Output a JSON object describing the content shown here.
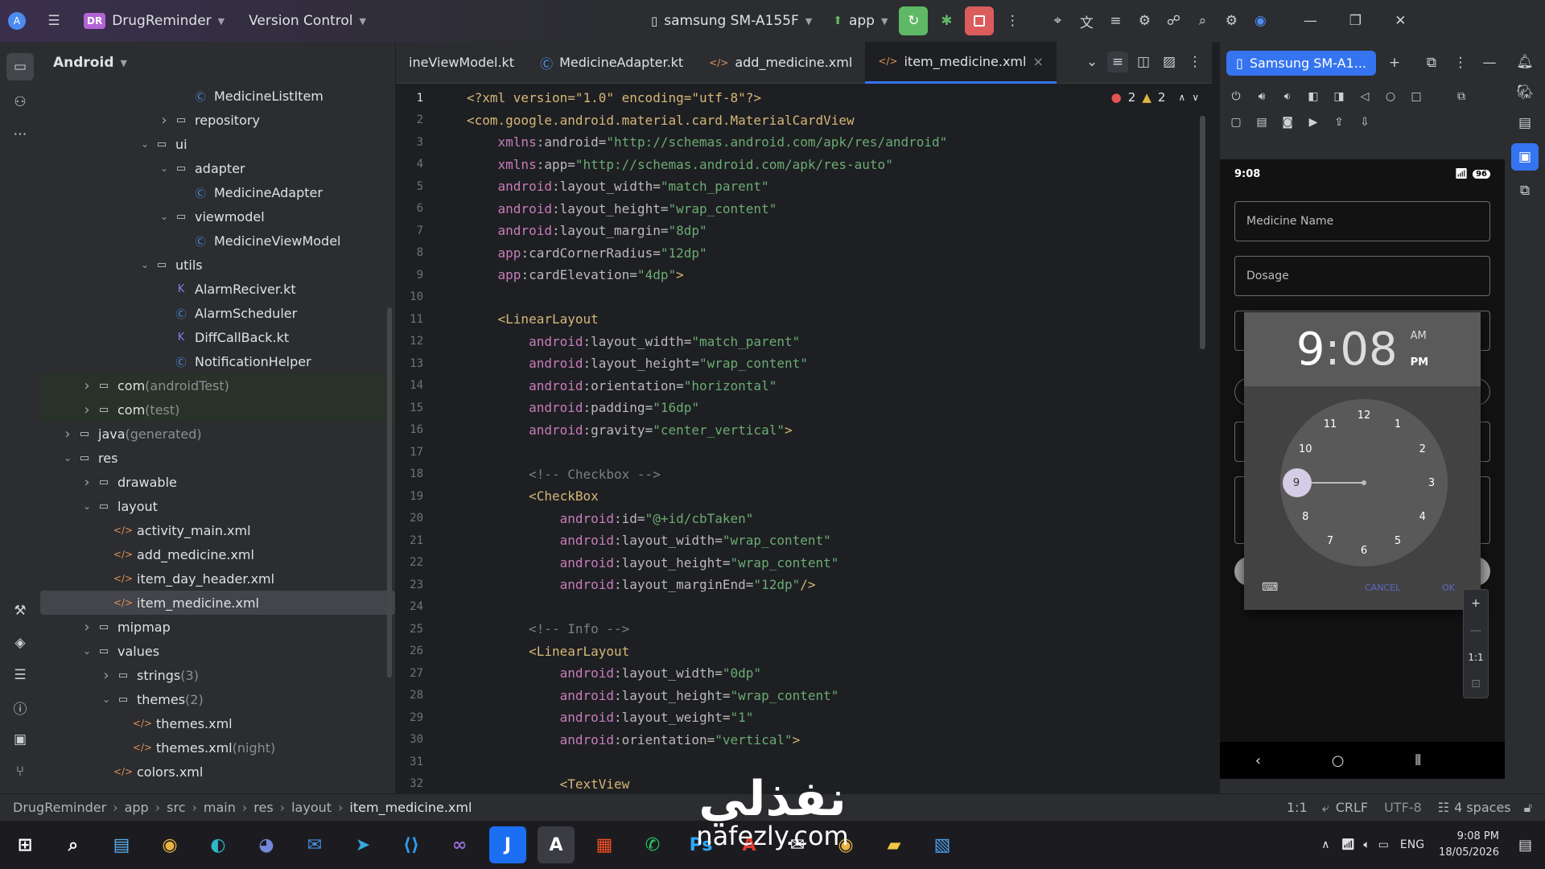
{
  "titlebar": {
    "project_badge": "DR",
    "project_name": "DrugReminder",
    "vcs": "Version Control",
    "device": "samsung SM-A155F",
    "run_config": "app"
  },
  "project_panel": {
    "view_mode": "Android",
    "rows": [
      {
        "label": "MedicineListItem",
        "suffix": "",
        "icon": "class-icon",
        "indent": 7,
        "arrow": ""
      },
      {
        "label": "repository",
        "suffix": "",
        "icon": "folder-icon",
        "indent": 6,
        "arrow": "collapsed"
      },
      {
        "label": "ui",
        "suffix": "",
        "icon": "folder-icon",
        "indent": 5,
        "arrow": "expanded"
      },
      {
        "label": "adapter",
        "suffix": "",
        "icon": "folder-icon",
        "indent": 6,
        "arrow": "expanded"
      },
      {
        "label": "MedicineAdapter",
        "suffix": "",
        "icon": "class-icon",
        "indent": 7,
        "arrow": ""
      },
      {
        "label": "viewmodel",
        "suffix": "",
        "icon": "folder-icon",
        "indent": 6,
        "arrow": "expanded"
      },
      {
        "label": "MedicineViewModel",
        "suffix": "",
        "icon": "class-icon",
        "indent": 7,
        "arrow": ""
      },
      {
        "label": "utils",
        "suffix": "",
        "icon": "folder-icon",
        "indent": 5,
        "arrow": "expanded"
      },
      {
        "label": "AlarmReciver.kt",
        "suffix": "",
        "icon": "kotlin-file-icon",
        "indent": 6,
        "arrow": ""
      },
      {
        "label": "AlarmScheduler",
        "suffix": "",
        "icon": "class-icon",
        "indent": 6,
        "arrow": ""
      },
      {
        "label": "DiffCallBack.kt",
        "suffix": "",
        "icon": "kotlin-file-icon",
        "indent": 6,
        "arrow": ""
      },
      {
        "label": "NotificationHelper",
        "suffix": "",
        "icon": "class-icon",
        "indent": 6,
        "arrow": ""
      },
      {
        "label": "com",
        "suffix": " (androidTest)",
        "icon": "folder-icon",
        "indent": 2,
        "arrow": "collapsed"
      },
      {
        "label": "com",
        "suffix": " (test)",
        "icon": "folder-icon",
        "indent": 2,
        "arrow": "collapsed"
      },
      {
        "label": "java",
        "suffix": " (generated)",
        "icon": "folder-icon",
        "indent": 1,
        "arrow": "collapsed"
      },
      {
        "label": "res",
        "suffix": "",
        "icon": "folder-icon",
        "indent": 1,
        "arrow": "expanded"
      },
      {
        "label": "drawable",
        "suffix": "",
        "icon": "folder-icon",
        "indent": 2,
        "arrow": "collapsed"
      },
      {
        "label": "layout",
        "suffix": "",
        "icon": "folder-icon",
        "indent": 2,
        "arrow": "expanded"
      },
      {
        "label": "activity_main.xml",
        "suffix": "",
        "icon": "xml-file-icon",
        "indent": 3,
        "arrow": ""
      },
      {
        "label": "add_medicine.xml",
        "suffix": "",
        "icon": "xml-file-icon",
        "indent": 3,
        "arrow": ""
      },
      {
        "label": "item_day_header.xml",
        "suffix": "",
        "icon": "xml-file-icon",
        "indent": 3,
        "arrow": ""
      },
      {
        "label": "item_medicine.xml",
        "suffix": "",
        "icon": "xml-file-icon",
        "indent": 3,
        "arrow": "",
        "selected": true
      },
      {
        "label": "mipmap",
        "suffix": "",
        "icon": "folder-icon",
        "indent": 2,
        "arrow": "collapsed"
      },
      {
        "label": "values",
        "suffix": "",
        "icon": "folder-icon",
        "indent": 2,
        "arrow": "expanded"
      },
      {
        "label": "strings",
        "suffix": " (3)",
        "icon": "folder-icon",
        "indent": 3,
        "arrow": "collapsed"
      },
      {
        "label": "themes",
        "suffix": " (2)",
        "icon": "folder-icon",
        "indent": 3,
        "arrow": "expanded"
      },
      {
        "label": "themes.xml",
        "suffix": "",
        "icon": "xml-file-icon",
        "indent": 4,
        "arrow": ""
      },
      {
        "label": "themes.xml",
        "suffix": " (night)",
        "icon": "xml-file-icon",
        "indent": 4,
        "arrow": ""
      },
      {
        "label": "colors.xml",
        "suffix": "",
        "icon": "xml-file-icon",
        "indent": 3,
        "arrow": ""
      }
    ]
  },
  "editor": {
    "tabs": [
      {
        "label": "ineViewModel.kt",
        "icon": "kotlin-file-icon",
        "active": false
      },
      {
        "label": "MedicineAdapter.kt",
        "icon": "class-icon",
        "active": false
      },
      {
        "label": "add_medicine.xml",
        "icon": "xml-file-icon",
        "active": false
      },
      {
        "label": "item_medicine.xml",
        "icon": "xml-file-icon",
        "active": true
      }
    ],
    "errors": "2",
    "warnings": "2",
    "lines": [
      [
        [
          "tag",
          "<?xml version=\"1.0\" encoding=\"utf-8\"?>"
        ]
      ],
      [
        [
          "tag",
          "<com.google.android.material.card.MaterialCardView"
        ]
      ],
      [
        [
          "t",
          "    "
        ],
        [
          "attrns",
          "xmlns"
        ],
        [
          "attr",
          ":android="
        ],
        [
          "str",
          "\"http://schemas.android.com/apk/res/android\""
        ]
      ],
      [
        [
          "t",
          "    "
        ],
        [
          "attrns",
          "xmlns"
        ],
        [
          "attr",
          ":app="
        ],
        [
          "str",
          "\"http://schemas.android.com/apk/res-auto\""
        ]
      ],
      [
        [
          "t",
          "    "
        ],
        [
          "attrns",
          "android"
        ],
        [
          "attr",
          ":layout_width="
        ],
        [
          "str",
          "\"match_parent\""
        ]
      ],
      [
        [
          "t",
          "    "
        ],
        [
          "attrns",
          "android"
        ],
        [
          "attr",
          ":layout_height="
        ],
        [
          "str",
          "\"wrap_content\""
        ]
      ],
      [
        [
          "t",
          "    "
        ],
        [
          "attrns",
          "android"
        ],
        [
          "attr",
          ":layout_margin="
        ],
        [
          "str",
          "\"8dp\""
        ]
      ],
      [
        [
          "t",
          "    "
        ],
        [
          "attrns",
          "app"
        ],
        [
          "attr",
          ":cardCornerRadius="
        ],
        [
          "str",
          "\"12dp\""
        ]
      ],
      [
        [
          "t",
          "    "
        ],
        [
          "attrns",
          "app"
        ],
        [
          "attr",
          ":cardElevation="
        ],
        [
          "str",
          "\"4dp\""
        ],
        [
          "tag",
          ">"
        ]
      ],
      [],
      [
        [
          "t",
          "    "
        ],
        [
          "tag",
          "<LinearLayout"
        ]
      ],
      [
        [
          "t",
          "        "
        ],
        [
          "attrns",
          "android"
        ],
        [
          "attr",
          ":layout_width="
        ],
        [
          "str",
          "\"match_parent\""
        ]
      ],
      [
        [
          "t",
          "        "
        ],
        [
          "attrns",
          "android"
        ],
        [
          "attr",
          ":layout_height="
        ],
        [
          "str",
          "\"wrap_content\""
        ]
      ],
      [
        [
          "t",
          "        "
        ],
        [
          "attrns",
          "android"
        ],
        [
          "attr",
          ":orientation="
        ],
        [
          "str",
          "\"horizontal\""
        ]
      ],
      [
        [
          "t",
          "        "
        ],
        [
          "attrns",
          "android"
        ],
        [
          "attr",
          ":padding="
        ],
        [
          "str",
          "\"16dp\""
        ]
      ],
      [
        [
          "t",
          "        "
        ],
        [
          "attrns",
          "android"
        ],
        [
          "attr",
          ":gravity="
        ],
        [
          "str",
          "\"center_vertical\""
        ],
        [
          "tag",
          ">"
        ]
      ],
      [],
      [
        [
          "t",
          "        "
        ],
        [
          "com",
          "<!-- Checkbox -->"
        ]
      ],
      [
        [
          "t",
          "        "
        ],
        [
          "tag",
          "<CheckBox"
        ]
      ],
      [
        [
          "t",
          "            "
        ],
        [
          "attrns",
          "android"
        ],
        [
          "attr",
          ":id="
        ],
        [
          "str",
          "\"@+id/cbTaken\""
        ]
      ],
      [
        [
          "t",
          "            "
        ],
        [
          "attrns",
          "android"
        ],
        [
          "attr",
          ":layout_width="
        ],
        [
          "str",
          "\"wrap_content\""
        ]
      ],
      [
        [
          "t",
          "            "
        ],
        [
          "attrns",
          "android"
        ],
        [
          "attr",
          ":layout_height="
        ],
        [
          "str",
          "\"wrap_content\""
        ]
      ],
      [
        [
          "t",
          "            "
        ],
        [
          "attrns",
          "android"
        ],
        [
          "attr",
          ":layout_marginEnd="
        ],
        [
          "str",
          "\"12dp\""
        ],
        [
          "tag",
          "/>"
        ]
      ],
      [],
      [
        [
          "t",
          "        "
        ],
        [
          "com",
          "<!-- Info -->"
        ]
      ],
      [
        [
          "t",
          "        "
        ],
        [
          "tag",
          "<LinearLayout"
        ]
      ],
      [
        [
          "t",
          "            "
        ],
        [
          "attrns",
          "android"
        ],
        [
          "attr",
          ":layout_width="
        ],
        [
          "str",
          "\"0dp\""
        ]
      ],
      [
        [
          "t",
          "            "
        ],
        [
          "attrns",
          "android"
        ],
        [
          "attr",
          ":layout_height="
        ],
        [
          "str",
          "\"wrap_content\""
        ]
      ],
      [
        [
          "t",
          "            "
        ],
        [
          "attrns",
          "android"
        ],
        [
          "attr",
          ":layout_weight="
        ],
        [
          "str",
          "\"1\""
        ]
      ],
      [
        [
          "t",
          "            "
        ],
        [
          "attrns",
          "android"
        ],
        [
          "attr",
          ":orientation="
        ],
        [
          "str",
          "\"vertical\""
        ],
        [
          "tag",
          ">"
        ]
      ],
      [],
      [
        [
          "t",
          "            "
        ],
        [
          "tag",
          "<TextView"
        ]
      ]
    ]
  },
  "emulator": {
    "device_tab": "Samsung SM-A1...",
    "phone": {
      "time": "9:08",
      "battery": "96",
      "fields": [
        "Medicine Name",
        "Dosage"
      ],
      "picker": {
        "hour": "9",
        "colon": ":",
        "minute": "08",
        "am": "AM",
        "pm": "PM",
        "selected_hour": 9,
        "numbers": [
          "12",
          "1",
          "2",
          "3",
          "4",
          "5",
          "6",
          "7",
          "8",
          "9",
          "10",
          "11"
        ],
        "cancel": "CANCEL",
        "ok": "OK"
      }
    },
    "zoom_label": "1:1"
  },
  "statusbar": {
    "breadcrumbs": [
      "DrugReminder",
      "app",
      "src",
      "main",
      "res",
      "layout",
      "item_medicine.xml"
    ],
    "position": "1:1",
    "line_sep": "CRLF",
    "encoding": "UTF-8",
    "indent": "4 spaces"
  },
  "taskbar": {
    "lang": "ENG",
    "time": "9:08 PM",
    "date": "18/05/2026"
  },
  "watermark": {
    "arabic": "نفذلي",
    "latin": "nafezly.com"
  },
  "colors": {
    "accent": "#3574f0",
    "run_green": "#5fb865",
    "stop_red": "#db5c5c"
  }
}
